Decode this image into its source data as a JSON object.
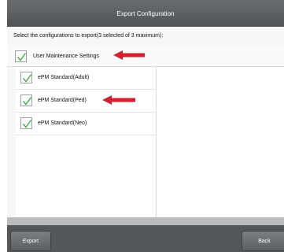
{
  "window": {
    "title": "Export Configuration"
  },
  "instruction": "Select the configurations to export(3 selected of 3 maximum):",
  "options": {
    "user_maintenance": {
      "label": "User Maintenance Settings",
      "checked": true
    },
    "items": [
      {
        "label": "ePM Standard(Adult)",
        "checked": true
      },
      {
        "label": "ePM Standard(Ped)",
        "checked": true
      },
      {
        "label": "ePM Standard(Neo)",
        "checked": true
      }
    ]
  },
  "buttons": {
    "export": "Export",
    "back": "Back"
  },
  "colors": {
    "check": "#3fae49",
    "annotation_arrow": "#d61f2b",
    "titlebar": "#5c6063"
  },
  "icons": {
    "checkmark": "check-icon",
    "arrow": "arrow-left-icon"
  }
}
